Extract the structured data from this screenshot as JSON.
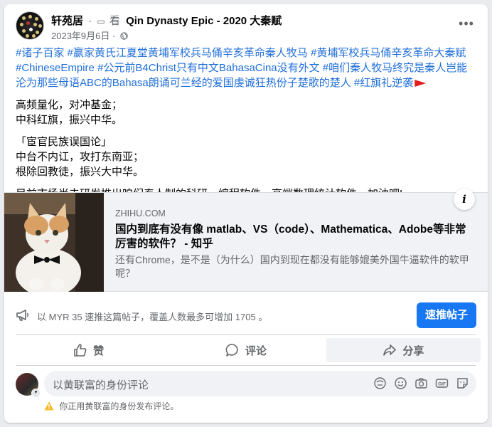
{
  "header": {
    "author": "轩苑居",
    "watch_label": "看",
    "page_name": "Qin Dynasty Epic - 2020 大秦赋",
    "timestamp": "2023年9月6日",
    "separator": "·",
    "privacy_icon": "globe-icon",
    "more_icon": "more-horizontal-icon"
  },
  "post": {
    "hashtags": "#诸子百家 #嬴家黄氏江夏堂黄埔军校兵马俑辛亥革命秦人牧马 #黄埔军校兵马俑辛亥革命大秦赋 #ChineseEmpire #公元前B4Christ只有中文BahasaCina没有外文 #咱们秦人牧马终究是秦人岂能沦为那些母语ABC的Bahasa朗诵可兰经的爱国虔诚狂热份子楚歌的楚人 #红旗礼逆袭",
    "para1_line1": "高频量化，对冲基金；",
    "para1_line2": "中科红旗，振兴中华。",
    "para2_line1": "「宦官民族误国论」",
    "para2_line2": "中台不内讧，攻打东南亚；",
    "para2_line3": "根除回教徒，振兴大中华。",
    "para3": "目前市场尚未研发推出咱们秦人制的科研、编程软件、高端数理统计软件，加油吧!"
  },
  "link_preview": {
    "domain": "ZHIHU.COM",
    "title": "国内到底有没有像 matlab、VS（code）、Mathematica、Adobe等非常厉害的软件？ - 知乎",
    "description": "还有Chrome，是不是（为什么）国内到现在都没有能够媲美外国牛逼软件的软甲呢？",
    "info_label": "i"
  },
  "boost": {
    "text": "以 MYR 35 速推这篇帖子，覆盖人数最多可增加 1705 。",
    "button": "速推帖子"
  },
  "actions": {
    "like": "赞",
    "comment": "评论",
    "share": "分享"
  },
  "comment_box": {
    "placeholder": "以黄联富的身份评论",
    "note": "你正用黄联富的身份发布评论。"
  },
  "colors": {
    "accent": "#1877f2",
    "hashtag": "#216fdb",
    "secondary_text": "#65676b"
  }
}
